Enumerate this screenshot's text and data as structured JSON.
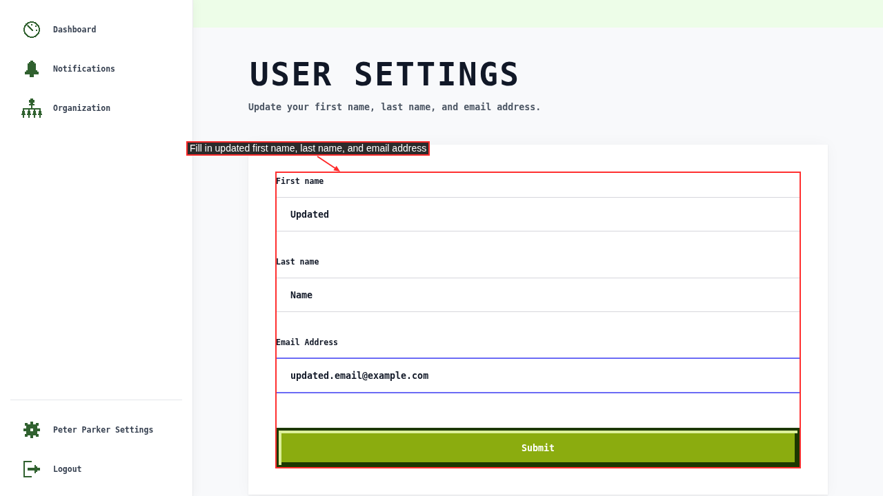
{
  "sidebar": {
    "items": [
      {
        "label": "Dashboard"
      },
      {
        "label": "Notifications"
      },
      {
        "label": "Organization"
      }
    ],
    "footer_items": [
      {
        "label": "Peter Parker Settings"
      },
      {
        "label": "Logout"
      }
    ]
  },
  "page": {
    "title": "USER SETTINGS",
    "subtitle": "Update your first name, last name, and email address."
  },
  "form": {
    "fields": [
      {
        "label": "First name",
        "value": "Updated",
        "focused": false
      },
      {
        "label": "Last name",
        "value": "Name",
        "focused": false
      },
      {
        "label": "Email Address",
        "value": "updated.email@example.com",
        "focused": true
      }
    ],
    "submit": "Submit"
  },
  "annotation": {
    "label": "Fill in updated first name, last name, and email address"
  }
}
